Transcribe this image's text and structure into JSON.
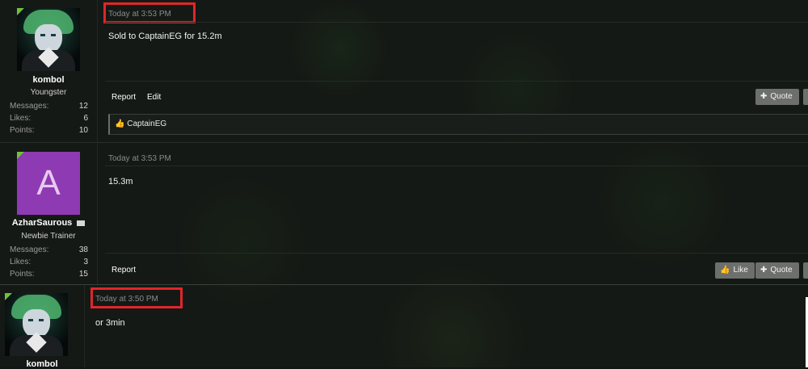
{
  "posts": [
    {
      "username": "kombol",
      "user_title": "Youngster",
      "stats": [
        {
          "label": "Messages:",
          "value": "12"
        },
        {
          "label": "Likes:",
          "value": "6"
        },
        {
          "label": "Points:",
          "value": "10"
        }
      ],
      "date": "Today at 3:53 PM",
      "message": "Sold to CaptainEG for 15.2m",
      "actions": {
        "report": "Report",
        "edit": "Edit",
        "quote": "Quote"
      },
      "liked_by": "CaptainEG"
    },
    {
      "avatar_letter": "A",
      "username": "AzharSaurous",
      "user_title": "Newbie Trainer",
      "stats": [
        {
          "label": "Messages:",
          "value": "38"
        },
        {
          "label": "Likes:",
          "value": "3"
        },
        {
          "label": "Points:",
          "value": "15"
        }
      ],
      "date": "Today at 3:53 PM",
      "message": "15.3m",
      "actions": {
        "report": "Report",
        "like": "Like",
        "quote": "Quote"
      }
    },
    {
      "username": "kombol",
      "date": "Today at 3:50 PM",
      "message": "or 3min"
    }
  ],
  "colors": {
    "highlight": "#e0262b",
    "online_corner": "#6ec23a",
    "letter_avatar": "#8e3ab3"
  }
}
